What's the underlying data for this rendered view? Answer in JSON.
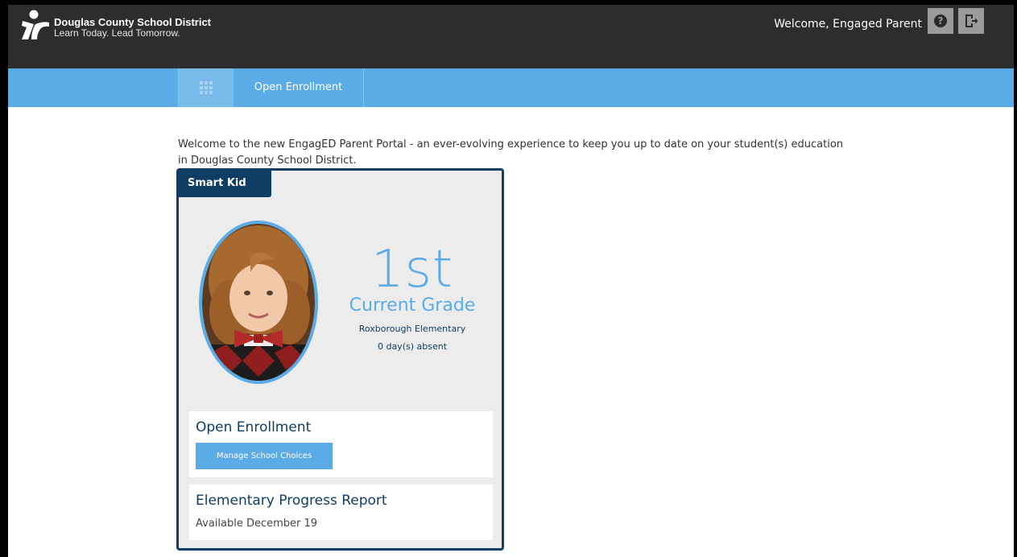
{
  "header": {
    "brand_name": "Douglas County School District",
    "brand_tagline": "Learn Today. Lead Tomorrow.",
    "welcome_text": "Welcome, Engaged Parent",
    "help_icon": "help-icon",
    "logout_icon": "logout-icon",
    "help_glyph": "?"
  },
  "nav": {
    "apps_icon": "apps-grid-icon",
    "tab_label": "Open Enrollment"
  },
  "main": {
    "intro": "Welcome to the new EngagED Parent Portal - an ever-evolving experience to keep you up to date on your student(s) education in Douglas County School District."
  },
  "student_card": {
    "name": "Smart Kid",
    "grade": "1st",
    "grade_label": "Current Grade",
    "school": "Roxborough Elementary",
    "absences": "0 day(s) absent",
    "enrollment": {
      "title": "Open Enrollment",
      "button_label": "Manage School Choices"
    },
    "progress_report": {
      "title": "Elementary Progress Report",
      "availability": "Available December 19"
    }
  },
  "colors": {
    "header_bg": "#2d2d2d",
    "nav_bg": "#5aabe6",
    "accent": "#5aabe6",
    "card_border": "#0f3d64"
  }
}
